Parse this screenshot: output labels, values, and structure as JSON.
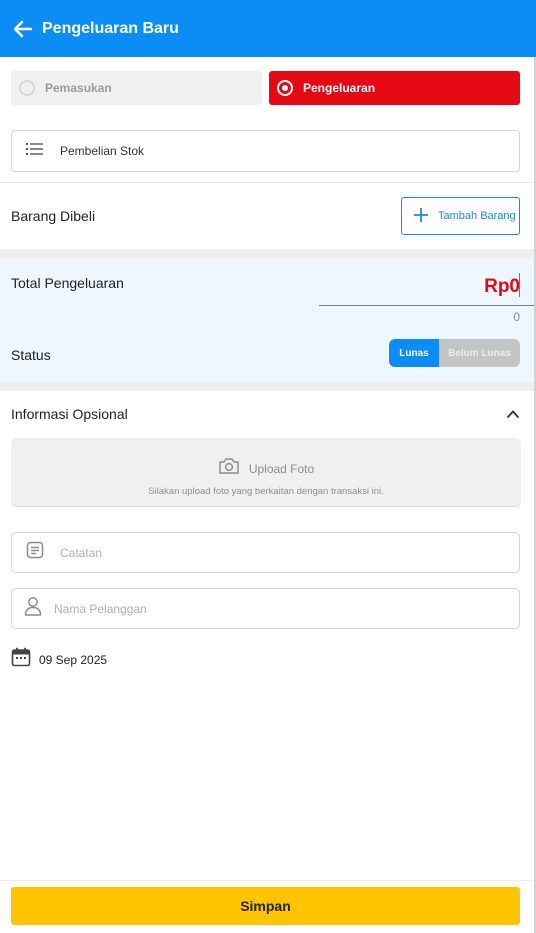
{
  "header": {
    "title": "Pengeluaran Baru",
    "back_icon": "arrow-left-icon",
    "background": "#0a8ef5"
  },
  "transaction_type": {
    "options": [
      {
        "label": "Pemasukan",
        "selected": false
      },
      {
        "label": "Pengeluaran",
        "selected": true
      }
    ],
    "active_color": "#e50914"
  },
  "category": {
    "icon": "list-icon",
    "value": "Pembelian Stok"
  },
  "items": {
    "label": "Barang Dibeli",
    "add_button_label": "Tambah Barang",
    "add_icon": "plus-icon"
  },
  "total": {
    "label": "Total Pengeluaran",
    "amount": "Rp0",
    "counter": "0"
  },
  "status": {
    "label": "Status",
    "options": [
      "Lunas",
      "Belum Lunas"
    ],
    "selected": "Lunas"
  },
  "optional": {
    "title": "Informasi Opsional",
    "expanded": true,
    "upload": {
      "title": "Upload Foto",
      "subtitle": "Silakan upload foto yang berkaitan dengan transaksi ini.",
      "icon": "camera-icon"
    },
    "note": {
      "placeholder": "Catatan",
      "icon": "note-icon"
    },
    "customer": {
      "placeholder": "Nama Pelanggan",
      "icon": "user-icon"
    },
    "date": {
      "value": "09 Sep 2025",
      "icon": "calendar-icon"
    }
  },
  "footer": {
    "save_label": "Simpan",
    "save_color": "#ffc400"
  }
}
